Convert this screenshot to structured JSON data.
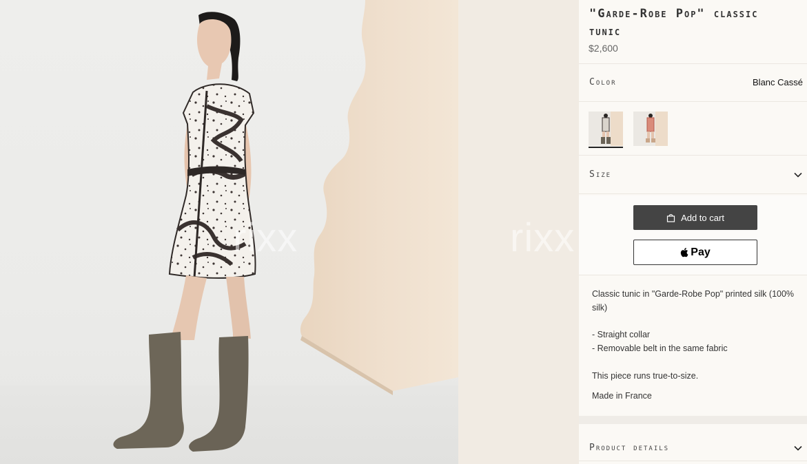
{
  "product": {
    "title": "\"Garde-Robe Pop\" classic tunic",
    "price": "$2,600"
  },
  "color": {
    "label": "Color",
    "selected": "Blanc Cassé",
    "swatches": [
      {
        "name": "swatch-blanc-casse",
        "selected": true
      },
      {
        "name": "swatch-alternate",
        "selected": false
      }
    ]
  },
  "size": {
    "label": "Size",
    "icon": "chevron-down-icon"
  },
  "actions": {
    "add_to_cart": "Add to cart",
    "add_to_cart_icon": "shopping-bag-icon",
    "apple_pay": "Pay",
    "apple_pay_icon": "apple-logo-icon"
  },
  "description": {
    "intro": "Classic tunic in \"Garde-Robe Pop\" printed silk (100% silk)",
    "bullet_1": "- Straight collar",
    "bullet_2": "- Removable belt in the same fabric",
    "fit": "This piece runs true-to-size.",
    "origin": "Made in France"
  },
  "product_details": {
    "label": "Product details",
    "icon": "chevron-down-icon"
  },
  "watermark": {
    "text_1": "rixx",
    "text_2": "rixx"
  },
  "colors": {
    "button_dark": "#444444",
    "background": "#fbf9f5",
    "panel_wood": "#eddcc9"
  }
}
